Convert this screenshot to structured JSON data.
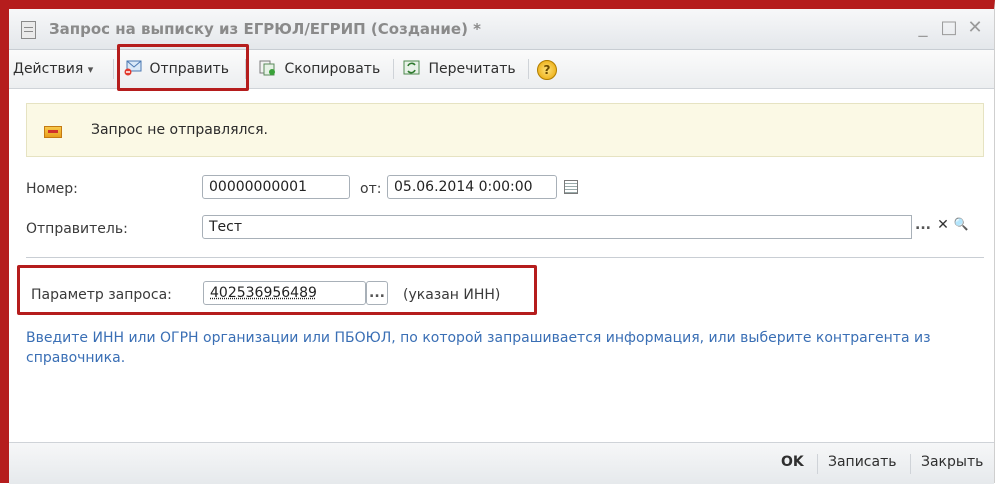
{
  "window": {
    "title": "Запрос на выписку из ЕГРЮЛ/ЕГРИП (Создание) *",
    "minimize_glyph": "_",
    "maximize_glyph": "□",
    "close_glyph": "✕"
  },
  "toolbar": {
    "actions_label": "Действия",
    "actions_arrow": "▾",
    "send_label": "Отправить",
    "copy_label": "Скопировать",
    "reread_label": "Перечитать",
    "help_glyph": "?"
  },
  "banner": {
    "text": "Запрос не отправлялся."
  },
  "form": {
    "number_label": "Номер:",
    "number_value": "00000000001",
    "from_label": "от:",
    "date_value": "05.06.2014  0:00:00",
    "sender_label": "Отправитель:",
    "sender_value": "Тест",
    "sender_select_glyph": "...",
    "sender_clear_glyph": "✕",
    "sender_search_glyph": "🔍",
    "param_label": "Параметр запроса:",
    "param_value": "402536956489",
    "param_select_glyph": "...",
    "param_note": "(указан ИНН)"
  },
  "hint": {
    "text": "Введите ИНН или ОГРН организации или ПБОЮЛ, по которой запрашивается информация, или выберите контрагента из справочника."
  },
  "footer": {
    "ok_label": "OK",
    "save_label": "Записать",
    "close_label": "Закрыть"
  },
  "colors": {
    "annotation_red": "#b51d1d",
    "hint_blue": "#3a6fb5",
    "banner_bg": "#fbf9e5"
  }
}
